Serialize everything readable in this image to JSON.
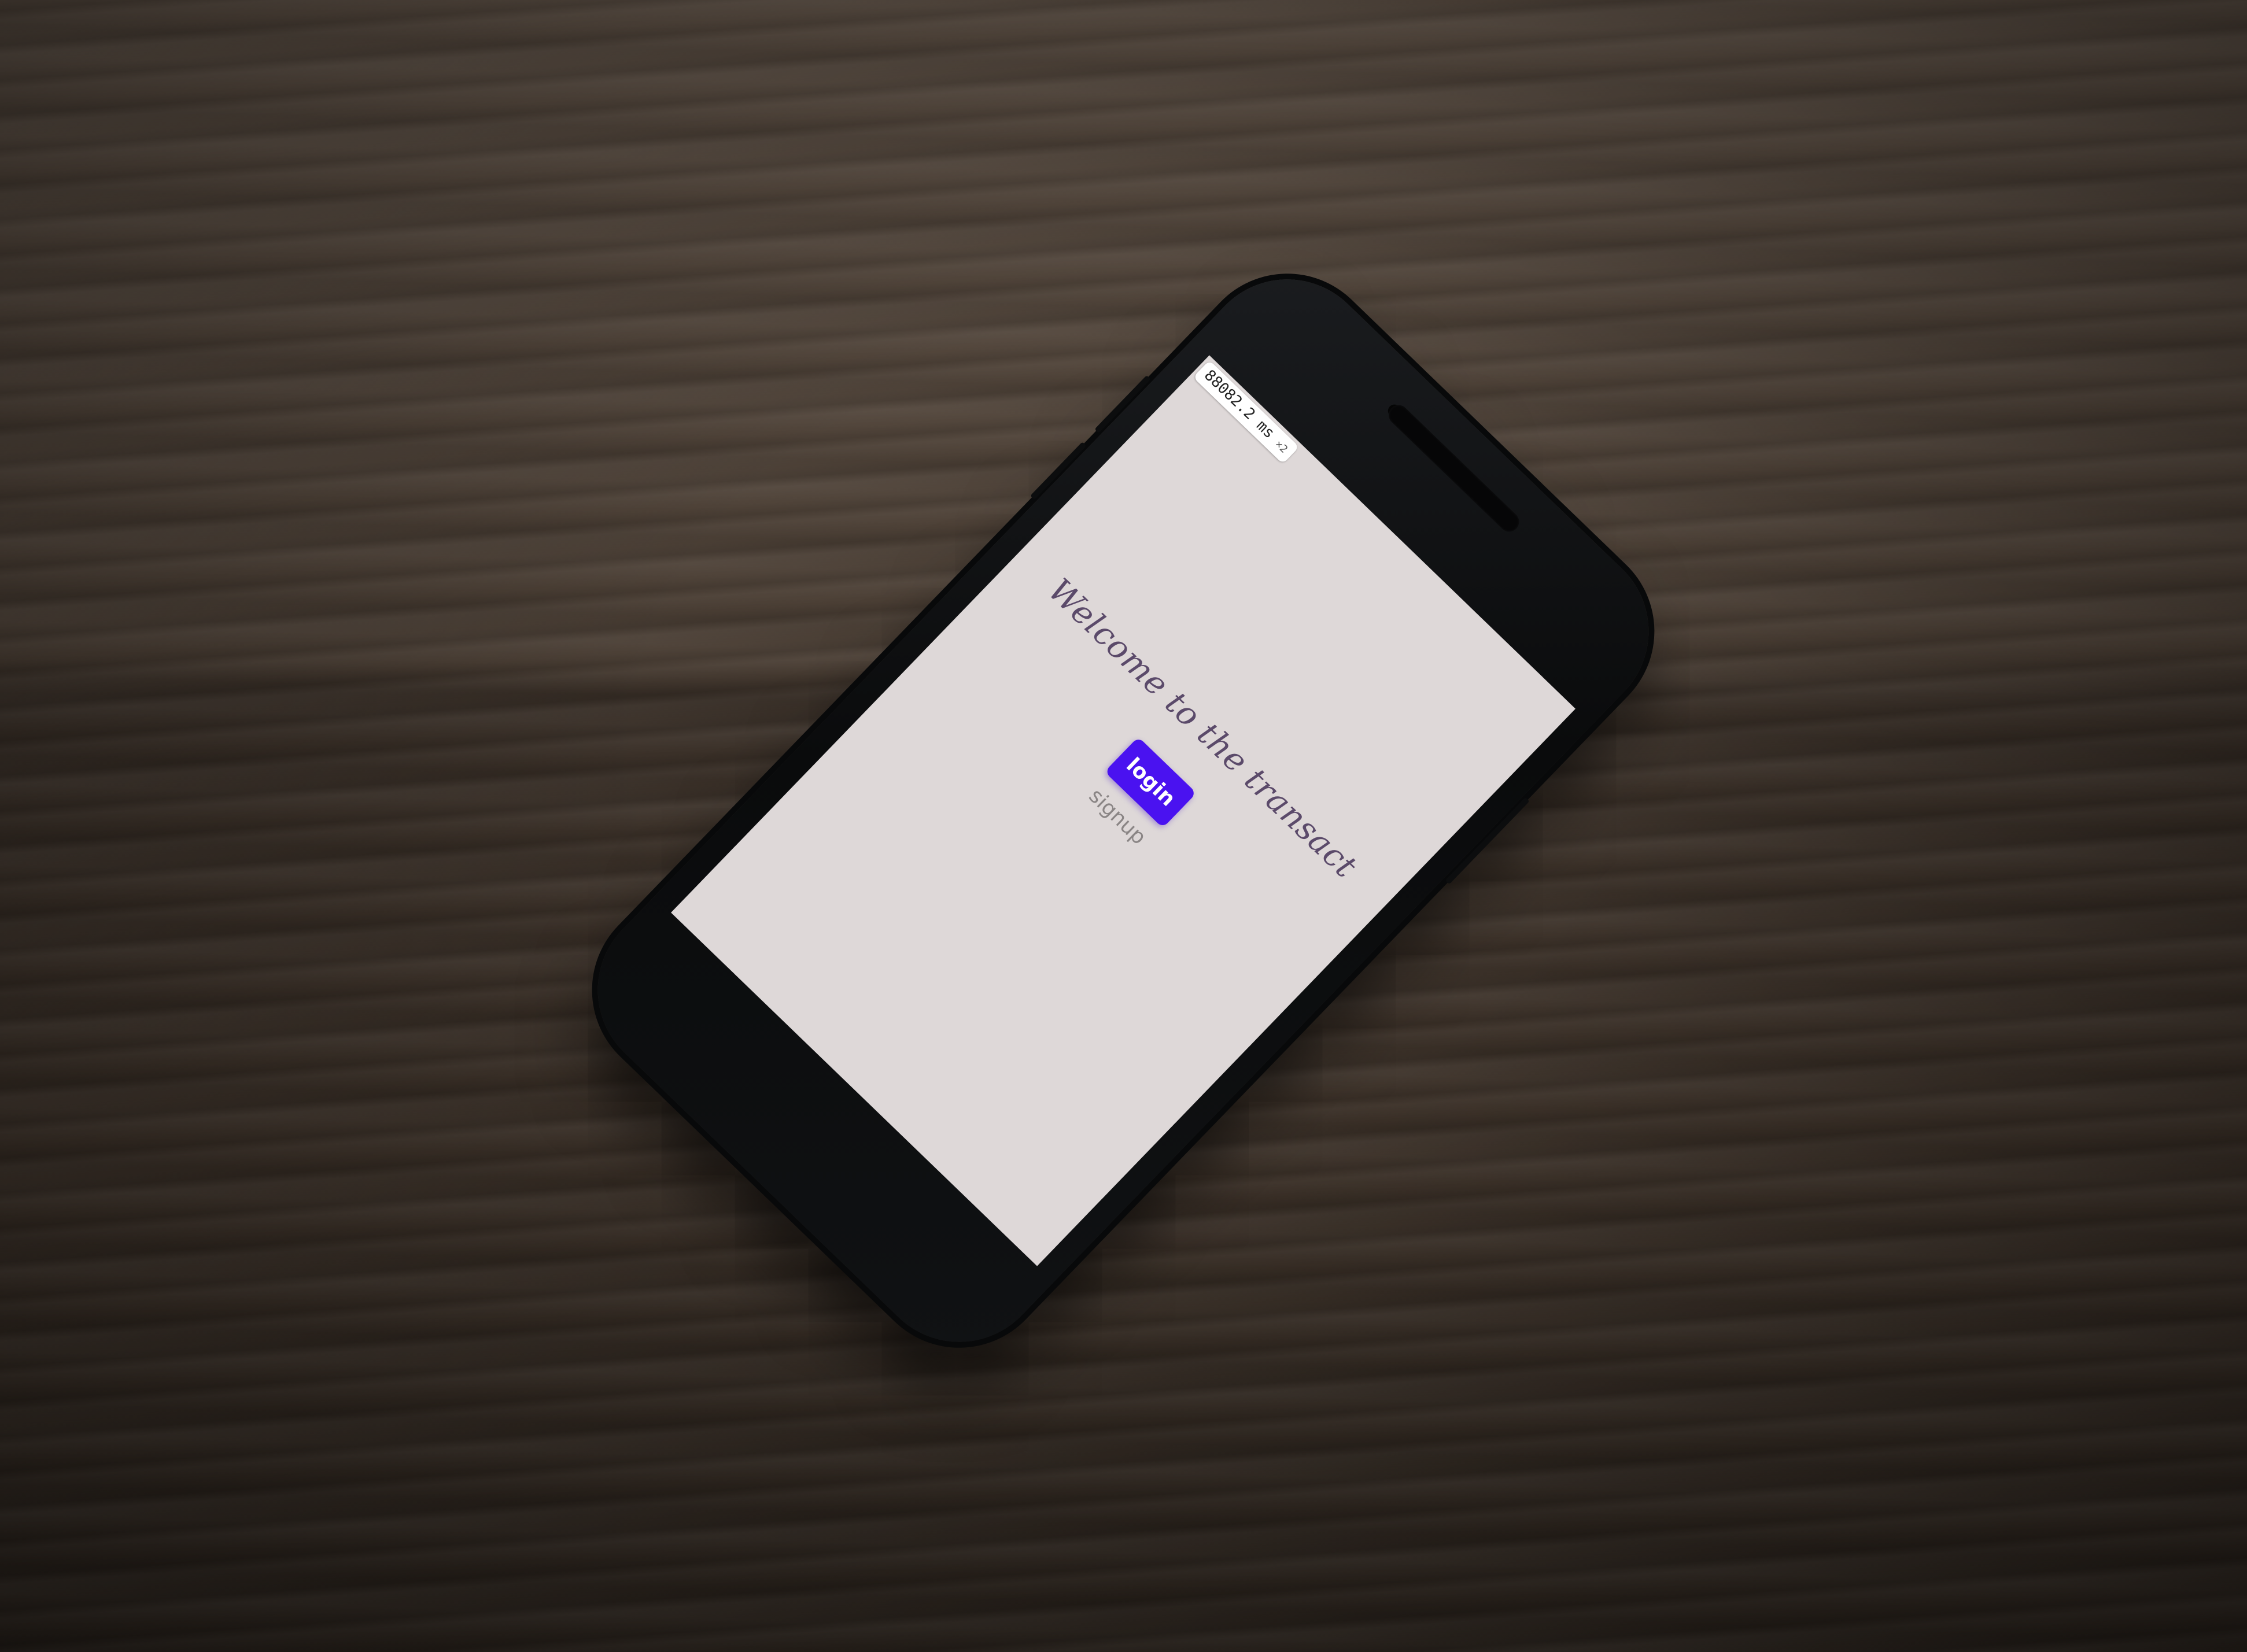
{
  "app": {
    "perf_badge": {
      "value": "88082.2 ms",
      "multiplier": "×2"
    },
    "welcome_text": "Welcome to the transact",
    "login_label": "login",
    "signup_label": "signup"
  },
  "colors": {
    "screen_background": "#ded8d8",
    "login_button": "#4a12f0",
    "welcome_text": "#5b4a6a",
    "signup_text": "#8a8585"
  }
}
